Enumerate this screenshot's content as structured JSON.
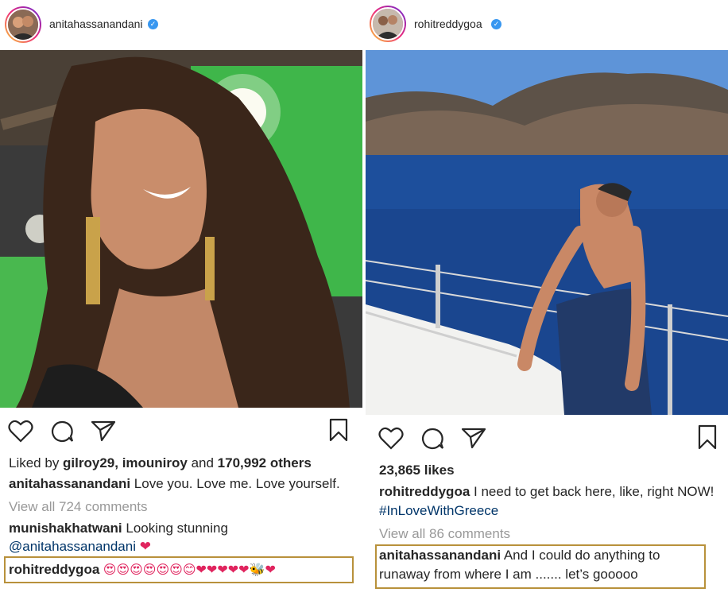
{
  "left_post": {
    "username": "anitahassanandani",
    "likes": {
      "prefix": "Liked by ",
      "users": "gilroy29, imouniroy",
      "and": " and ",
      "count": "170,992 others"
    },
    "caption": {
      "username": "anitahassanandani",
      "text": " Love you. Love me. Love yourself."
    },
    "view_comments": "View all 724 comments",
    "comments": [
      {
        "username": "munishakhatwani",
        "text": " Looking stunning",
        "mention": "@anitahassanandani",
        "emoji": " ❤"
      },
      {
        "username": "rohitreddygoa",
        "emojis": " 😍😍😍😍😍😍😊❤❤❤❤❤🐝❤"
      }
    ]
  },
  "right_post": {
    "username": "rohitreddygoa",
    "likes": "23,865 likes",
    "caption": {
      "username": "rohitreddygoa",
      "text": " I need to get back here, like, right NOW!",
      "hashtag": "#InLoveWithGreece"
    },
    "view_comments": "View all 86 comments",
    "comments": [
      {
        "username": "anitahassanandani",
        "text_line1": " And I could do anything to",
        "text_line2": "runaway from where I am ....... let’s gooooo"
      }
    ]
  },
  "colors": {
    "verified": "#3897f0",
    "highlight_border": "#b8913b",
    "link": "#003569",
    "muted": "#999999"
  }
}
